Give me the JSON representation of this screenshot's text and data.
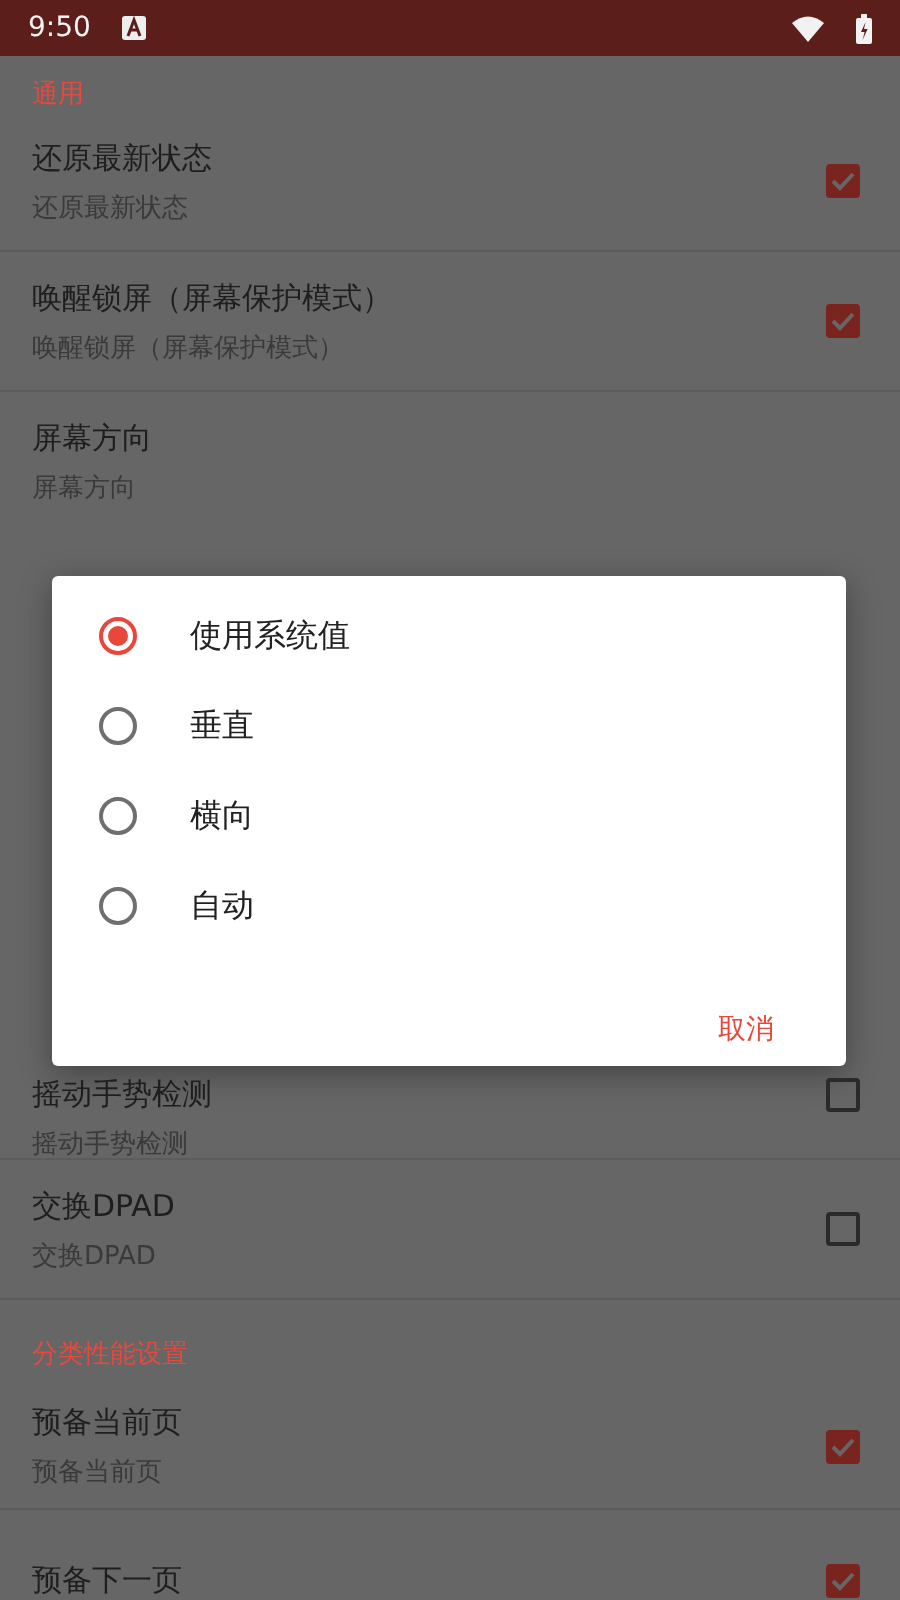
{
  "status_bar": {
    "time": "9:50"
  },
  "sections_above": [
    {
      "header": "通用",
      "items": [
        {
          "title": "还原最新状态",
          "subtitle": "还原最新状态",
          "checked": true
        },
        {
          "title": "唤醒锁屏（屏幕保护模式）",
          "subtitle": "唤醒锁屏（屏幕保护模式）",
          "checked": true
        },
        {
          "title": "屏幕方向",
          "subtitle": "屏幕方向"
        }
      ]
    }
  ],
  "dialog": {
    "options": [
      {
        "label": "使用系统值",
        "selected": true
      },
      {
        "label": "垂直",
        "selected": false
      },
      {
        "label": "横向",
        "selected": false
      },
      {
        "label": "自动",
        "selected": false
      }
    ],
    "buttons": [
      "取消"
    ]
  },
  "sections_below": [
    {
      "items": [
        {
          "title": "摇动手势检测",
          "subtitle": "摇动手势检测",
          "checked": false
        },
        {
          "title": "交换DPAD",
          "subtitle": "交换DPAD",
          "checked": false
        }
      ]
    },
    {
      "header": "分类性能设置",
      "items": [
        {
          "title": "预备当前页",
          "subtitle": "预备当前页",
          "checked": true
        },
        {
          "title": "预备下一页",
          "checked": true
        }
      ]
    }
  ]
}
